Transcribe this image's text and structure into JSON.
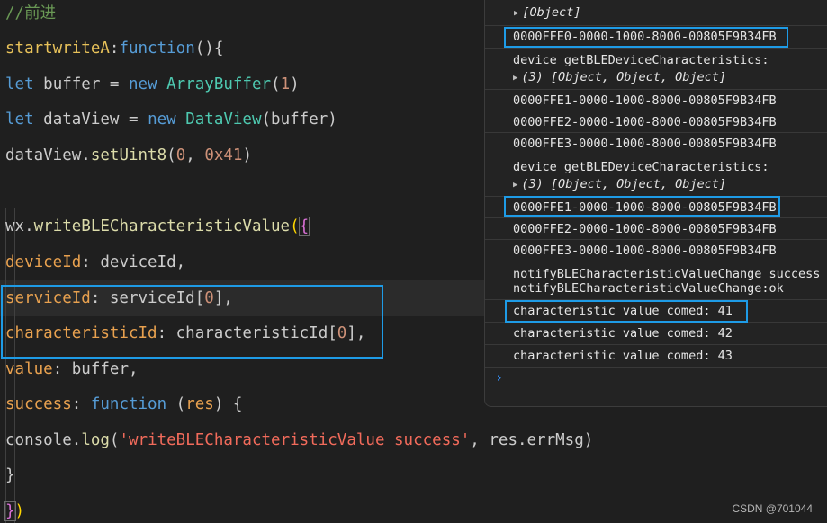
{
  "editor": {
    "lines": [
      [
        {
          "t": "//前进",
          "c": "cmt"
        }
      ],
      [
        {
          "t": "startwriteA",
          "c": "yfn"
        },
        {
          "t": ":",
          "c": "pl"
        },
        {
          "t": "function",
          "c": "kw"
        },
        {
          "t": "(){",
          "c": "pl"
        }
      ],
      [
        {
          "t": "let ",
          "c": "kw"
        },
        {
          "t": "buffer",
          "c": "pl"
        },
        {
          "t": " = ",
          "c": "pl"
        },
        {
          "t": "new ",
          "c": "kw"
        },
        {
          "t": "ArrayBuffer",
          "c": "cls"
        },
        {
          "t": "(",
          "c": "pl"
        },
        {
          "t": "1",
          "c": "num"
        },
        {
          "t": ")",
          "c": "pl"
        }
      ],
      [
        {
          "t": "let ",
          "c": "kw"
        },
        {
          "t": "dataView",
          "c": "pl"
        },
        {
          "t": " = ",
          "c": "pl"
        },
        {
          "t": "new ",
          "c": "kw"
        },
        {
          "t": "DataView",
          "c": "cls"
        },
        {
          "t": "(buffer)",
          "c": "pl"
        }
      ],
      [
        {
          "t": "dataView",
          "c": "pl"
        },
        {
          "t": ".",
          "c": "pl"
        },
        {
          "t": "setUint8",
          "c": "fn"
        },
        {
          "t": "(",
          "c": "pl"
        },
        {
          "t": "0",
          "c": "num"
        },
        {
          "t": ", ",
          "c": "pl"
        },
        {
          "t": "0x41",
          "c": "num"
        },
        {
          "t": ")",
          "c": "pl"
        }
      ],
      [],
      [
        {
          "t": "wx",
          "c": "pl"
        },
        {
          "t": ".",
          "c": "pl"
        },
        {
          "t": "writeBLECharacteristicValue",
          "c": "fn"
        },
        {
          "t": "(",
          "c": "gold"
        },
        {
          "t": "{",
          "c": "pink",
          "box": true
        }
      ],
      [
        {
          "t": "deviceId",
          "c": "prop"
        },
        {
          "t": ": deviceId,",
          "c": "pl"
        }
      ],
      [
        {
          "t": "serviceId",
          "c": "prop"
        },
        {
          "t": ": serviceId[",
          "c": "pl"
        },
        {
          "t": "0",
          "c": "num"
        },
        {
          "t": "],",
          "c": "pl"
        }
      ],
      [
        {
          "t": "characteristicId",
          "c": "prop"
        },
        {
          "t": ": characteristicId[",
          "c": "pl"
        },
        {
          "t": "0",
          "c": "num"
        },
        {
          "t": "],",
          "c": "pl"
        }
      ],
      [
        {
          "t": "value",
          "c": "prop"
        },
        {
          "t": ": buffer,",
          "c": "pl"
        }
      ],
      [
        {
          "t": "success",
          "c": "prop"
        },
        {
          "t": ": ",
          "c": "pl"
        },
        {
          "t": "function",
          "c": "kw"
        },
        {
          "t": " (",
          "c": "pl"
        },
        {
          "t": "res",
          "c": "prop"
        },
        {
          "t": ") {",
          "c": "pl"
        }
      ],
      [
        {
          "t": "console",
          "c": "pl"
        },
        {
          "t": ".",
          "c": "pl"
        },
        {
          "t": "log",
          "c": "fn"
        },
        {
          "t": "(",
          "c": "pl"
        },
        {
          "t": "'writeBLECharacteristicValue success'",
          "c": "str"
        },
        {
          "t": ", res.errMsg)",
          "c": "pl"
        }
      ],
      [
        {
          "t": "}",
          "c": "pl"
        }
      ],
      [
        {
          "t": "}",
          "c": "pink",
          "box": true
        },
        {
          "t": ")",
          "c": "gold"
        }
      ]
    ]
  },
  "console": {
    "rows": [
      {
        "text": "[Object]",
        "italic": true,
        "arrow": true
      },
      {
        "text": "0000FFE0-0000-1000-8000-00805F9B34FB"
      },
      {
        "text": "device getBLEDeviceCharacteristics:",
        "sub": "(3) [Object, Object, Object]"
      },
      {
        "text": "0000FFE1-0000-1000-8000-00805F9B34FB"
      },
      {
        "text": "0000FFE2-0000-1000-8000-00805F9B34FB"
      },
      {
        "text": "0000FFE3-0000-1000-8000-00805F9B34FB"
      },
      {
        "text": "device getBLEDeviceCharacteristics:",
        "sub": "(3) [Object, Object, Object]"
      },
      {
        "text": "0000FFE1-0000-1000-8000-00805F9B34FB"
      },
      {
        "text": "0000FFE2-0000-1000-8000-00805F9B34FB"
      },
      {
        "text": "0000FFE3-0000-1000-8000-00805F9B34FB"
      },
      {
        "text": "notifyBLECharacteristicValueChange success",
        "sub": "notifyBLECharacteristicValueChange:ok",
        "subPlain": true
      },
      {
        "text": "characteristic value comed: 41"
      },
      {
        "text": "characteristic value comed: 42"
      },
      {
        "text": "characteristic value comed: 43"
      }
    ],
    "prompt": "›"
  },
  "watermark": "CSDN @701044",
  "colors": {
    "annotation": "#1e9be6",
    "background": "#1f1f1f"
  }
}
